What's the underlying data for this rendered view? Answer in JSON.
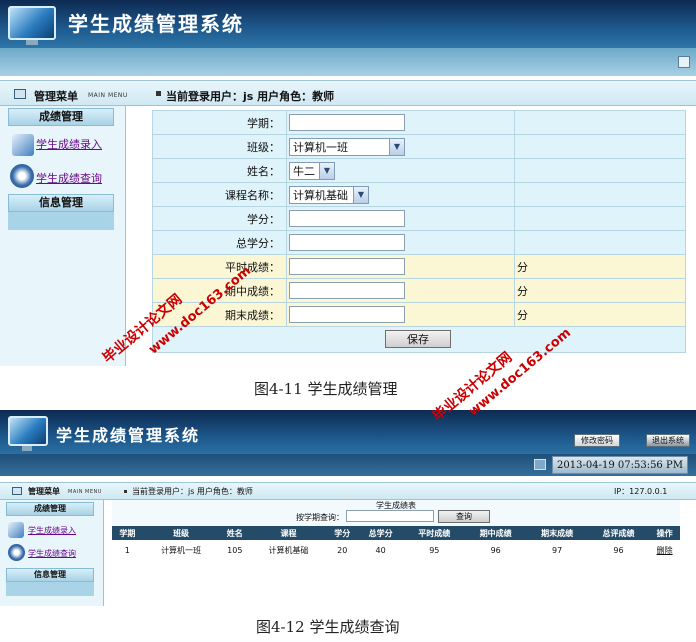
{
  "entry_screen": {
    "app_title": "学生成绩管理系统",
    "menu_strip": {
      "title": "管理菜单",
      "subtitle": "MAIN MENU"
    },
    "login_info": "当前登录用户：js 用户角色：教师",
    "sidebar": {
      "section1": "成绩管理",
      "link_entry": "学生成绩录入",
      "link_query": "学生成绩查询",
      "section2": "信息管理"
    },
    "form": {
      "rows": [
        {
          "label": "学期：",
          "type": "text",
          "value": "",
          "unit": ""
        },
        {
          "label": "班级：",
          "type": "select",
          "value": "计算机一班",
          "unit": ""
        },
        {
          "label": "姓名：",
          "type": "select",
          "value": "牛二",
          "unit": ""
        },
        {
          "label": "课程名称：",
          "type": "select",
          "value": "计算机基础",
          "unit": ""
        },
        {
          "label": "学分：",
          "type": "text",
          "value": "",
          "unit": ""
        },
        {
          "label": "总学分：",
          "type": "text",
          "value": "",
          "unit": ""
        },
        {
          "label": "平时成绩：",
          "type": "text",
          "value": "",
          "unit": "分"
        },
        {
          "label": "期中成绩：",
          "type": "text",
          "value": "",
          "unit": "分"
        },
        {
          "label": "期末成绩：",
          "type": "text",
          "value": "",
          "unit": "分"
        }
      ],
      "save_label": "保存"
    },
    "caption": "图4-11 学生成绩管理"
  },
  "query_screen": {
    "app_title": "学生成绩管理系统",
    "change_password": "修改密码",
    "logout": "退出系统",
    "datetime": "2013-04-19 07:53:56 PM",
    "menu_strip": {
      "title": "管理菜单",
      "subtitle": "MAIN MENU"
    },
    "login_info": "当前登录用户：js 用户角色：教师",
    "ip": "IP：127.0.0.1",
    "sidebar": {
      "section1": "成绩管理",
      "link_entry": "学生成绩录入",
      "link_query": "学生成绩查询",
      "section2": "信息管理"
    },
    "table_title": "学生成绩表",
    "search_label": "按学期查询：",
    "search_value": "",
    "search_button": "查询",
    "columns": [
      "学期",
      "班级",
      "姓名",
      "课程",
      "学分",
      "总学分",
      "平时成绩",
      "期中成绩",
      "期末成绩",
      "总评成绩",
      "操作"
    ],
    "rows": [
      [
        "1",
        "计算机一班",
        "105",
        "计算机基础",
        "20",
        "40",
        "95",
        "96",
        "97",
        "96",
        "删除"
      ]
    ],
    "caption": "图4-12 学生成绩查询"
  },
  "watermarks": {
    "line1": "毕业设计论文网",
    "line2": "www.doc163.com"
  },
  "colors": {
    "banner_dark": "#0d2a52",
    "banner_light": "#2f76a8",
    "sidebar_link": "#6a0a8a",
    "watermark": "#cc0000",
    "table_header": "#244b68"
  }
}
